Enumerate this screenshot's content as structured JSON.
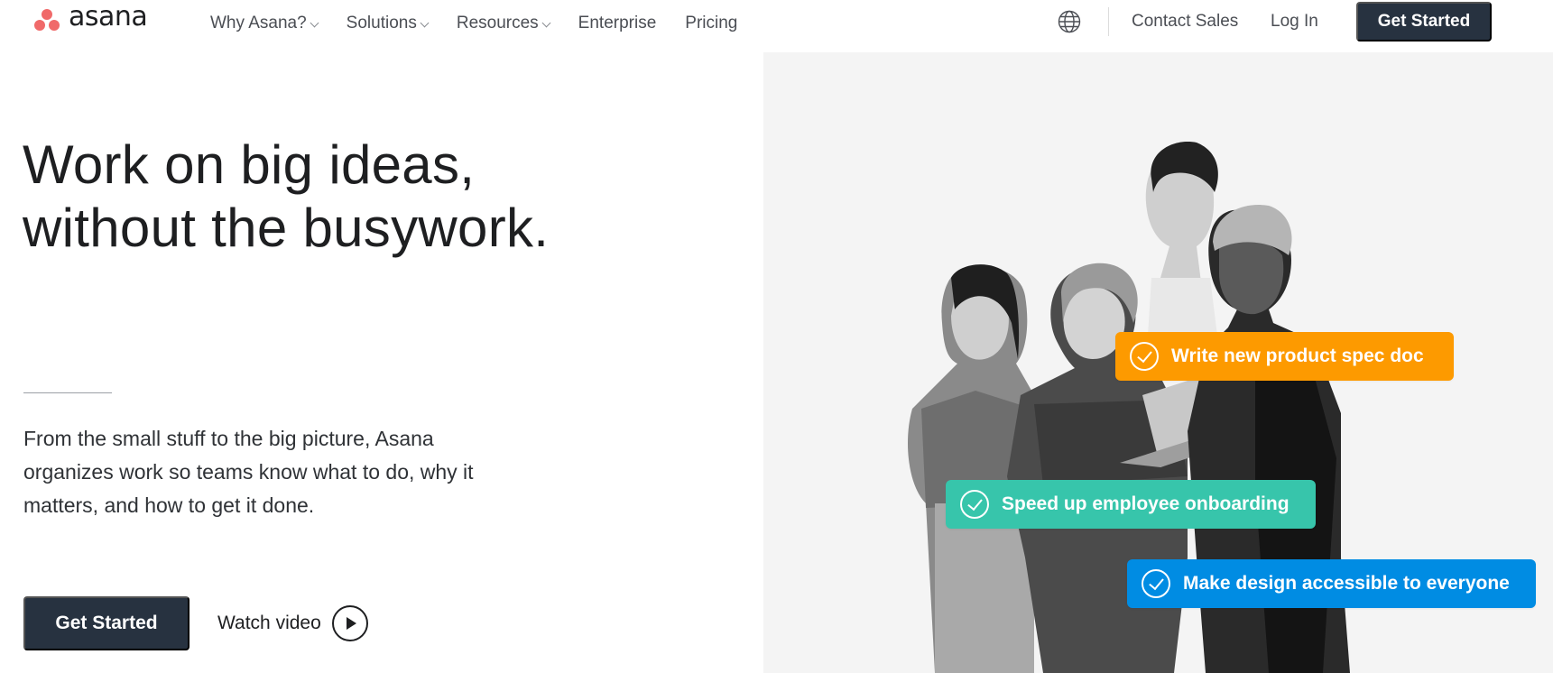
{
  "brand": {
    "name": "asana",
    "accent": "#f06a6a"
  },
  "nav": {
    "items": [
      {
        "label": "Why Asana?",
        "has_dropdown": true
      },
      {
        "label": "Solutions",
        "has_dropdown": true
      },
      {
        "label": "Resources",
        "has_dropdown": true
      },
      {
        "label": "Enterprise",
        "has_dropdown": false
      },
      {
        "label": "Pricing",
        "has_dropdown": false
      }
    ],
    "language_icon": "globe-icon",
    "contact_label": "Contact Sales",
    "login_label": "Log In",
    "cta_label": "Get Started",
    "cta_color": "#273240"
  },
  "hero": {
    "headline_line1": "Work on big ideas,",
    "headline_line2": "without the busywork.",
    "subtext": "From the small stuff to the big picture, Asana organizes work so teams know what to do, why it matters, and how to get it done.",
    "cta_label": "Get Started",
    "watch_label": "Watch video",
    "play_icon": "play-circle-icon"
  },
  "tasks": [
    {
      "label": "Write new product spec doc",
      "color": "#fd9a00",
      "icon": "check-circle-icon"
    },
    {
      "label": "Speed up employee onboarding",
      "color": "#37c5ab",
      "icon": "check-circle-icon"
    },
    {
      "label": "Make design accessible to everyone",
      "color": "#008ce3",
      "icon": "check-circle-icon"
    }
  ]
}
